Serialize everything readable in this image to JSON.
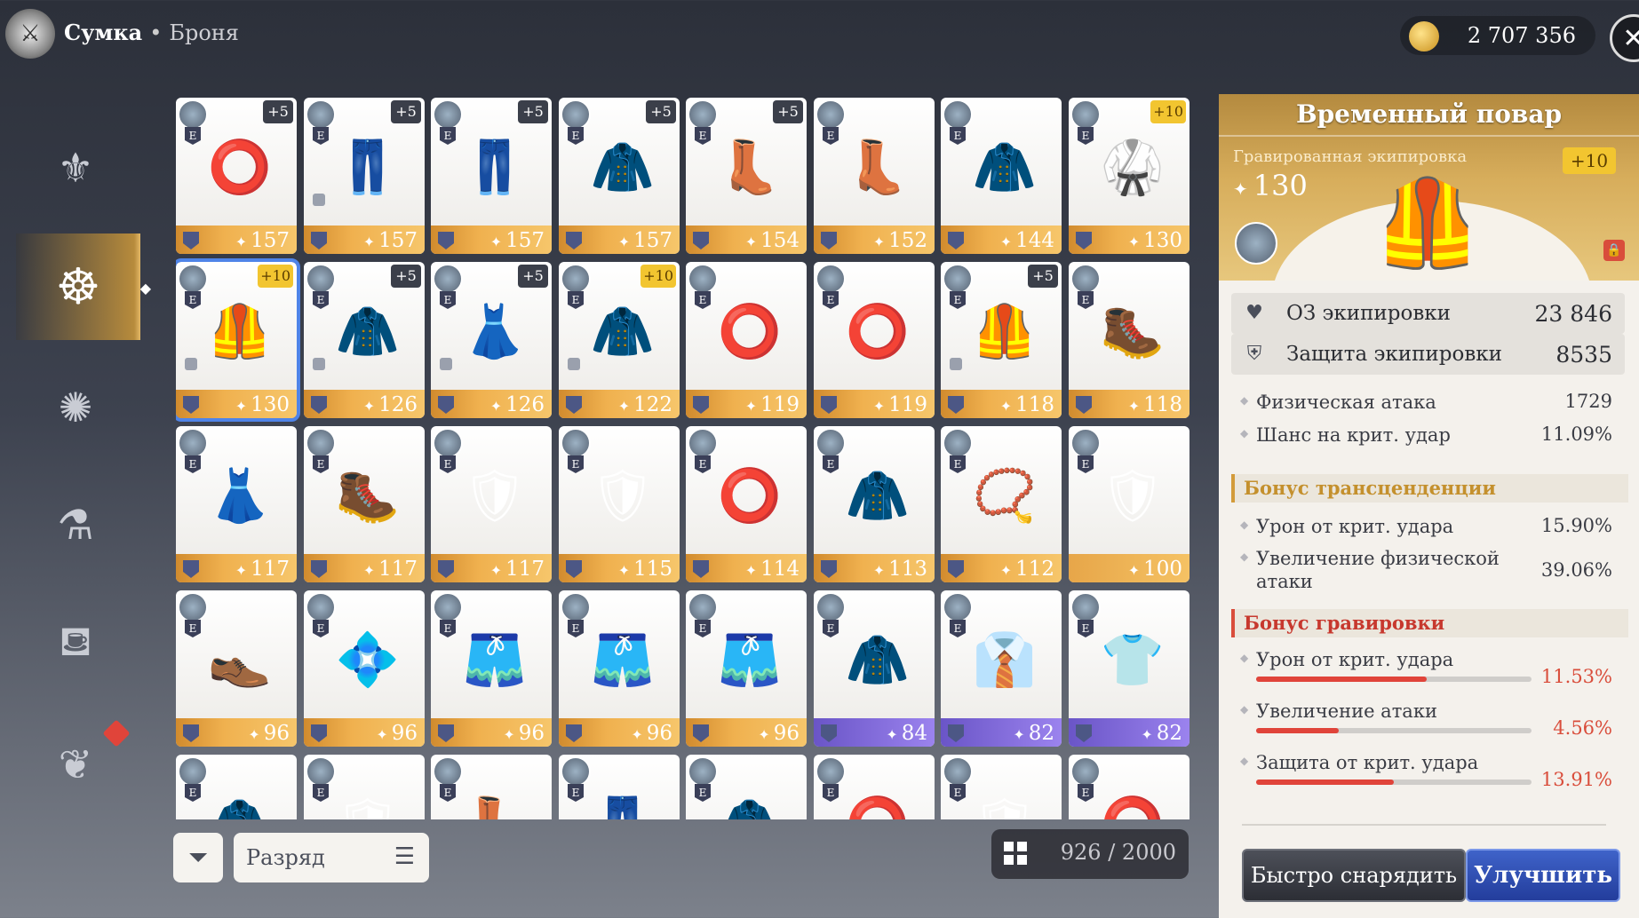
{
  "header": {
    "section": "Сумка",
    "subsection": "Броня",
    "gold": "2 707 356"
  },
  "sidebar": {
    "items": [
      "armor-icon",
      "cook-icon",
      "accessory-icon",
      "potion-icon",
      "food-icon",
      "bag-icon"
    ]
  },
  "inventory": {
    "cards": [
      {
        "plus": "+5",
        "power": "157",
        "art": "⭕",
        "bar": "gold"
      },
      {
        "plus": "+5",
        "power": "157",
        "art": "👖",
        "bar": "gold",
        "locked": true
      },
      {
        "plus": "+5",
        "power": "157",
        "art": "👖",
        "bar": "gold"
      },
      {
        "plus": "+5",
        "power": "157",
        "art": "🧥",
        "bar": "gold"
      },
      {
        "plus": "+5",
        "power": "154",
        "art": "👢",
        "bar": "gold"
      },
      {
        "plus": "",
        "power": "152",
        "art": "👢",
        "bar": "gold"
      },
      {
        "plus": "",
        "power": "144",
        "art": "🧥",
        "bar": "gold"
      },
      {
        "plus": "+10",
        "power": "130",
        "art": "🥋",
        "bar": "gold",
        "plus_gold": true
      },
      {
        "plus": "+10",
        "power": "130",
        "art": "🦺",
        "bar": "gold",
        "plus_gold": true,
        "selected": true,
        "locked": true
      },
      {
        "plus": "+5",
        "power": "126",
        "art": "🧥",
        "bar": "gold",
        "locked": true
      },
      {
        "plus": "+5",
        "power": "126",
        "art": "👗",
        "bar": "gold",
        "locked": true
      },
      {
        "plus": "+10",
        "power": "122",
        "art": "🧥",
        "bar": "gold",
        "plus_gold": true,
        "locked": true
      },
      {
        "plus": "",
        "power": "119",
        "art": "⭕",
        "bar": "gold"
      },
      {
        "plus": "",
        "power": "119",
        "art": "⭕",
        "bar": "gold"
      },
      {
        "plus": "+5",
        "power": "118",
        "art": "🦺",
        "bar": "gold",
        "locked": true
      },
      {
        "plus": "",
        "power": "118",
        "art": "🥾",
        "bar": "gold"
      },
      {
        "plus": "",
        "power": "117",
        "art": "👗",
        "bar": "gold"
      },
      {
        "plus": "",
        "power": "117",
        "art": "🥾",
        "bar": "gold"
      },
      {
        "plus": "",
        "power": "117",
        "art": "🛡",
        "bar": "gold"
      },
      {
        "plus": "",
        "power": "115",
        "art": "🛡",
        "bar": "gold"
      },
      {
        "plus": "",
        "power": "114",
        "art": "⭕",
        "bar": "gold"
      },
      {
        "plus": "",
        "power": "113",
        "art": "🧥",
        "bar": "gold"
      },
      {
        "plus": "",
        "power": "112",
        "art": "📿",
        "bar": "gold"
      },
      {
        "plus": "",
        "power": "100",
        "art": "🛡",
        "bar": "none"
      },
      {
        "plus": "",
        "power": "96",
        "art": "👞",
        "bar": "gold"
      },
      {
        "plus": "",
        "power": "96",
        "art": "💠",
        "bar": "gold"
      },
      {
        "plus": "",
        "power": "96",
        "art": "🩳",
        "bar": "gold"
      },
      {
        "plus": "",
        "power": "96",
        "art": "🩳",
        "bar": "gold"
      },
      {
        "plus": "",
        "power": "96",
        "art": "🩳",
        "bar": "gold"
      },
      {
        "plus": "",
        "power": "84",
        "art": "🧥",
        "bar": "purple"
      },
      {
        "plus": "",
        "power": "82",
        "art": "👔",
        "bar": "purple"
      },
      {
        "plus": "",
        "power": "82",
        "art": "👕",
        "bar": "purple"
      },
      {
        "plus": "",
        "power": "",
        "art": "🧥",
        "bar": "gold"
      },
      {
        "plus": "",
        "power": "",
        "art": "🛡",
        "bar": "gold"
      },
      {
        "plus": "",
        "power": "",
        "art": "👢",
        "bar": "gold"
      },
      {
        "plus": "",
        "power": "",
        "art": "👖",
        "bar": "gold"
      },
      {
        "plus": "",
        "power": "",
        "art": "🧥",
        "bar": "gold"
      },
      {
        "plus": "",
        "power": "",
        "art": "⭕",
        "bar": "gold"
      },
      {
        "plus": "",
        "power": "",
        "art": "🛡",
        "bar": "gold"
      },
      {
        "plus": "",
        "power": "",
        "art": "⭕",
        "bar": "gold"
      }
    ]
  },
  "controls": {
    "sort_label": "Разряд",
    "count": "926 / 2000"
  },
  "detail": {
    "title": "Временный повар",
    "engraved_label": "Гравированная экипировка",
    "engraved_power": "130",
    "plus": "+10",
    "hp_label": "ОЗ экипировки",
    "hp_value": "23 846",
    "def_label": "Защита экипировки",
    "def_value": "8535",
    "stats": [
      {
        "label": "Физическая атака",
        "value": "1729"
      },
      {
        "label": "Шанс на крит. удар",
        "value": "11.09%"
      }
    ],
    "transcendence_title": "Бонус трансценденции",
    "transcendence": [
      {
        "label": "Урон от крит. удара",
        "value": "15.90%"
      },
      {
        "label": "Увеличение физической атаки",
        "value": "39.06%"
      }
    ],
    "engraving_title": "Бонус гравировки",
    "engraving": [
      {
        "label": "Урон от крит. удара",
        "value": "11.53%",
        "fill": 0.62
      },
      {
        "label": "Увеличение атаки",
        "value": "4.56%",
        "fill": 0.3
      },
      {
        "label": "Защита от крит. удара",
        "value": "13.91%",
        "fill": 0.5
      }
    ],
    "equip_button": "Быстро снарядить",
    "upgrade_button": "Улучшить"
  },
  "colors": {
    "accent_gold": "#d39b3a",
    "accent_red": "#d94d3b",
    "upgrade_blue": "#2f52b8"
  }
}
